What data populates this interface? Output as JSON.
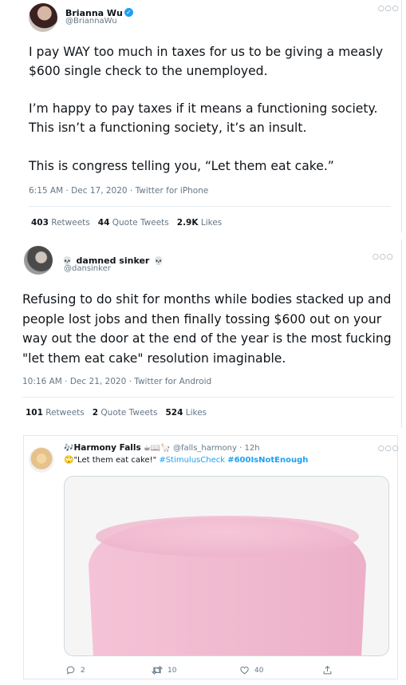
{
  "tweet1": {
    "name": "Brianna Wu",
    "handle": "@BriannaWu",
    "verified": true,
    "para1": "I pay WAY too much in taxes for us to be giving a measly $600 single check to the unemployed.",
    "para2": "I’m happy to pay taxes if it means a functioning society. This isn’t a functioning society, it’s an insult.",
    "para3": "This is congress telling you, “Let them eat cake.”",
    "meta": "6:15 AM · Dec 17, 2020 · Twitter for iPhone",
    "retweets_count": "403",
    "retweets_label": "Retweets",
    "quotes_count": "44",
    "quotes_label": "Quote Tweets",
    "likes_count": "2.9K",
    "likes_label": "Likes"
  },
  "tweet2": {
    "name": "damned sinker",
    "name_emoji": "💀",
    "handle": "@dansinker",
    "body": "Refusing to do shit for months while bodies stacked up and people lost jobs and then finally tossing $600 out on your way out the door at the end of the year is the most fucking \"let them eat cake\" resolution imaginable.",
    "meta": "10:16 AM · Dec 21, 2020 · Twitter for Android",
    "retweets_count": "101",
    "retweets_label": "Retweets",
    "quotes_count": "2",
    "quotes_label": "Quote Tweets",
    "likes_count": "524",
    "likes_label": "Likes"
  },
  "tweet3": {
    "name_prefix": "🎶",
    "name": "Harmony Falls",
    "name_emojis": "☕📖🦙",
    "handle": "@falls_harmony",
    "sep": "·",
    "time": "12h",
    "text_emoji": "🙄",
    "text_quote": "\"Let them eat cake!\"",
    "hashtag1": "#StimulusCheck",
    "hashtag2": "#600IsNotEnough",
    "replies": "2",
    "retweets": "10",
    "likes": "40"
  },
  "colors": {
    "link": "#1da1f2",
    "muted": "#657786",
    "text": "#0f1419",
    "cake": "#f1b9cf"
  }
}
